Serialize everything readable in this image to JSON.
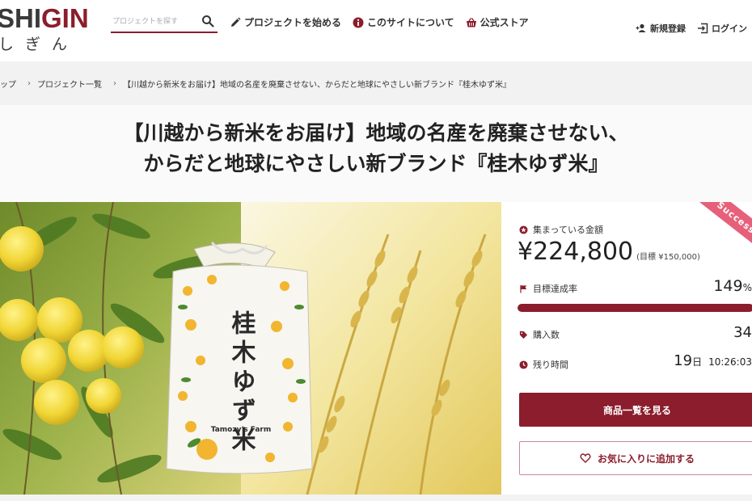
{
  "header": {
    "logo_prefix": "SHI",
    "logo_accent": "GIN",
    "logo_sub": "しぎん",
    "search_placeholder": "プロジェクトを探す",
    "nav": [
      {
        "label": "プロジェクトを始める",
        "icon": "pencil-icon"
      },
      {
        "label": "このサイトについて",
        "icon": "info-icon"
      },
      {
        "label": "公式ストア",
        "icon": "basket-icon"
      }
    ],
    "account": [
      {
        "label": "新規登録",
        "icon": "add-user-icon"
      },
      {
        "label": "ログイン",
        "icon": "login-icon"
      }
    ]
  },
  "breadcrumb": {
    "items": [
      "ップ",
      "プロジェクト一覧",
      "【川越から新米をお届け】地域の名産を廃棄させない、からだと地球にやさしい新ブランド『桂木ゆず米』"
    ]
  },
  "project": {
    "title_line1": "【川越から新米をお届け】地域の名産を廃棄させない、",
    "title_line2": "からだと地球にやさしい新ブランド『桂木ゆず米』",
    "hero_bag_text": "桂木ゆず米",
    "hero_brand": "Tamozy's Farm"
  },
  "stats": {
    "ribbon": "Success",
    "amount_label": "集まっている金額",
    "amount": "¥224,800",
    "goal": "(目標 ¥150,000)",
    "rate_label": "目標達成率",
    "rate": "149",
    "rate_unit": "%",
    "rate_fraction": 1.0,
    "buyers_label": "購入数",
    "buyers": "34",
    "remaining_label": "残り時間",
    "days": "19",
    "days_unit": "日",
    "clock": "10:26:03"
  },
  "actions": {
    "primary": "商品一覧を見る",
    "favorite": "お気に入りに追加する"
  },
  "colors": {
    "brand": "#8b1d2c",
    "ribbon": "#e6607a"
  }
}
